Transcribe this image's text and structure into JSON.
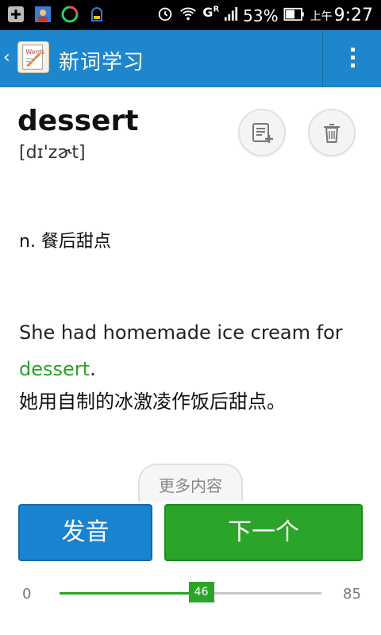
{
  "status_bar": {
    "battery": "53%",
    "ampm": "上午",
    "time": "9:27",
    "network": "G",
    "network_sub": "R",
    "icons": [
      "plus-icon",
      "contacts-icon",
      "sync-icon",
      "debug-icon",
      "alarm-icon",
      "wifi-icon",
      "signal-icon",
      "battery-icon"
    ]
  },
  "app_bar": {
    "title": "新词学习",
    "back_icon": "chevron-left-icon",
    "logo_icon": "words-notebook-icon",
    "menu_icon": "overflow-menu-icon",
    "color": "#1e86cc"
  },
  "word": {
    "text": "dessert",
    "phonetic": "[dɪ'zɚt]",
    "definition": "n. 餐后甜点",
    "example_pre": "She had homemade ice cream for",
    "example_highlight": "dessert",
    "example_post": ".",
    "example_zh": "她用自制的冰激凌作饭后甜点。",
    "highlight_color": "#2aa22a"
  },
  "actions": {
    "add_note_icon": "add-note-icon",
    "delete_icon": "trash-icon",
    "more_label": "更多内容",
    "pronounce_label": "发音",
    "next_label": "下一个"
  },
  "progress": {
    "min": "0",
    "max": "85",
    "current": "46",
    "current_value": 46,
    "max_value": 85
  }
}
